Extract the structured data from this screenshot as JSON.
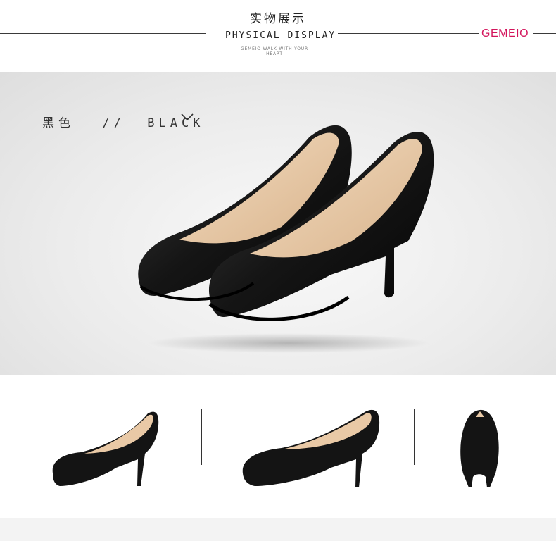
{
  "header": {
    "title_cn": "实物展示",
    "title_en": "PHYSICAL DISPLAY",
    "subtitle": "GEMEIO WALK WITH YOUR HEART",
    "brand": "GEMEIO",
    "brand_color": "#d3155c"
  },
  "hero": {
    "color_label_cn": "黑色",
    "color_sep": "//",
    "color_label_en": "BLACK",
    "icon": "chevron-down-icon",
    "image": "pair-of-black-pumps-photo"
  },
  "thumbnails": [
    {
      "name": "side-view-photo"
    },
    {
      "name": "three-quarter-view-photo"
    },
    {
      "name": "rear-view-photo"
    }
  ],
  "colors": {
    "shoe": "#151515",
    "insole": "#e9c9a6",
    "background": "#ececec"
  }
}
